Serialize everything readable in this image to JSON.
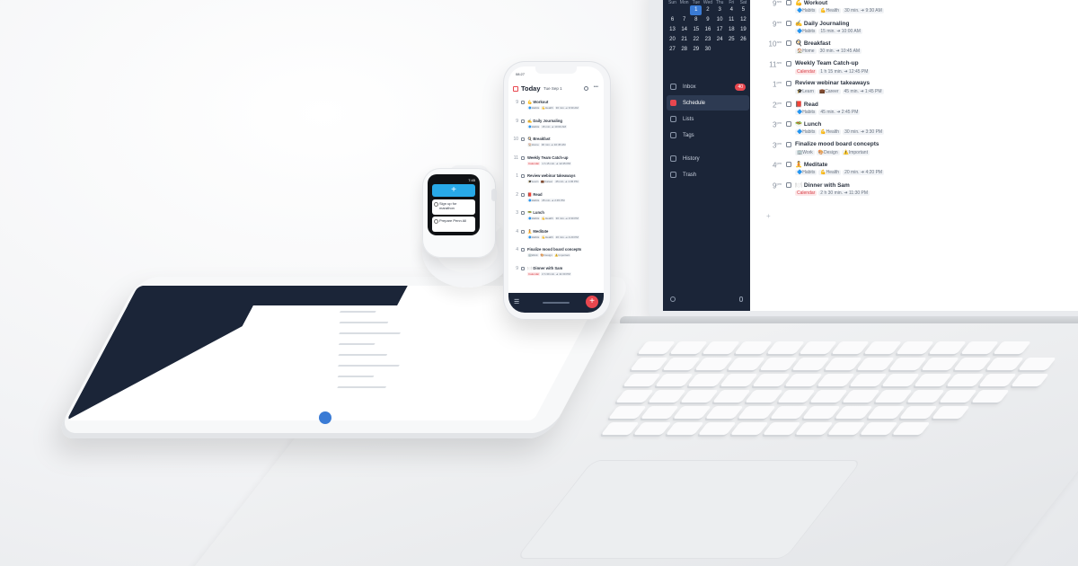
{
  "mac": {
    "calendar": {
      "weekdays": [
        "Sun",
        "Mon",
        "Tue",
        "Wed",
        "Thu",
        "Fri",
        "Sat"
      ],
      "weeks": [
        [
          "",
          "",
          "1",
          "2",
          "3",
          "4",
          "5"
        ],
        [
          "6",
          "7",
          "8",
          "9",
          "10",
          "11",
          "12"
        ],
        [
          "13",
          "14",
          "15",
          "16",
          "17",
          "18",
          "19"
        ],
        [
          "20",
          "21",
          "22",
          "23",
          "24",
          "25",
          "26"
        ],
        [
          "27",
          "28",
          "29",
          "30",
          "",
          "",
          ""
        ]
      ],
      "selected": "1"
    },
    "nav": [
      {
        "label": "Inbox",
        "badge": "40"
      },
      {
        "label": "Schedule",
        "badge": ""
      },
      {
        "label": "Lists",
        "badge": ""
      },
      {
        "label": "Tags",
        "badge": ""
      },
      {
        "label": "History",
        "badge": ""
      },
      {
        "label": "Trash",
        "badge": ""
      }
    ],
    "tasks": [
      {
        "time": "9",
        "ampm": "am",
        "title": "💪 Workout",
        "meta": [
          {
            "t": "🔷Habits"
          },
          {
            "t": "💪Health"
          },
          {
            "t": "30 min. ➜ 9:30 AM"
          }
        ]
      },
      {
        "time": "9",
        "ampm": "am",
        "title": "✍️ Daily Journaling",
        "meta": [
          {
            "t": "🔷Habits"
          },
          {
            "t": "15 min. ➜ 10:00 AM"
          }
        ]
      },
      {
        "time": "10",
        "ampm": "am",
        "title": "🍳 Breakfast",
        "meta": [
          {
            "t": "🏠Home"
          },
          {
            "t": "30 min. ➜ 10:45 AM"
          }
        ]
      },
      {
        "time": "11",
        "ampm": "am",
        "title": "Weekly Team Catch-up",
        "meta": [
          {
            "t": "Calendar",
            "red": true
          },
          {
            "t": "1 h 15 min. ➜ 12:45 PM"
          }
        ]
      },
      {
        "time": "1",
        "ampm": "pm",
        "title": "Review webinar takeaways",
        "meta": [
          {
            "t": "🎓Learn"
          },
          {
            "t": "💼Career"
          },
          {
            "t": "45 min. ➜ 1:45 PM"
          }
        ]
      },
      {
        "time": "2",
        "ampm": "pm",
        "title": "📕 Read",
        "meta": [
          {
            "t": "🔷Habits"
          },
          {
            "t": "45 min. ➜ 2:45 PM"
          }
        ]
      },
      {
        "time": "3",
        "ampm": "pm",
        "title": "🥗 Lunch",
        "meta": [
          {
            "t": "🔷Habits"
          },
          {
            "t": "💪Health"
          },
          {
            "t": "30 min. ➜ 3:30 PM"
          }
        ]
      },
      {
        "time": "3",
        "ampm": "pm",
        "title": "Finalize mood board concepts",
        "meta": [
          {
            "t": "🏢Work"
          },
          {
            "t": "🎨Design"
          },
          {
            "t": "⚠️Important"
          }
        ]
      },
      {
        "time": "4",
        "ampm": "pm",
        "title": "🧘 Meditate",
        "meta": [
          {
            "t": "🔷Habits"
          },
          {
            "t": "💪Health"
          },
          {
            "t": "20 min. ➜ 4:20 PM"
          }
        ]
      },
      {
        "time": "9",
        "ampm": "pm",
        "title": "🍽️ Dinner with Sam",
        "meta": [
          {
            "t": "Calendar",
            "red": true
          },
          {
            "t": "2 h 30 min. ➜ 11:30 PM"
          }
        ]
      }
    ]
  },
  "phone": {
    "status_time": "08:27",
    "title": "Today",
    "date": "Tue Sep 1",
    "tasks": [
      {
        "time": "9",
        "title": "💪 Workout",
        "meta": [
          {
            "t": "🔷Habits"
          },
          {
            "t": "💪Health"
          },
          {
            "t": "30 min. ➜ 9:30 AM"
          }
        ]
      },
      {
        "time": "9",
        "title": "✍️ Daily Journaling",
        "meta": [
          {
            "t": "🔷Habits"
          },
          {
            "t": "15 min. ➜ 10:00 AM"
          }
        ]
      },
      {
        "time": "10",
        "title": "🍳 Breakfast",
        "meta": [
          {
            "t": "🏠Home"
          },
          {
            "t": "30 min. ➜ 10:45 AM"
          }
        ]
      },
      {
        "time": "11",
        "title": "Weekly Team Catch-up",
        "meta": [
          {
            "t": "Calendar",
            "red": true
          },
          {
            "t": "1 h 15 min. ➜ 12:45 PM"
          }
        ]
      },
      {
        "time": "1",
        "title": "Review webinar takeaways",
        "meta": [
          {
            "t": "🎓Learn"
          },
          {
            "t": "💼Career"
          },
          {
            "t": "45 min. ➜ 1:45 PM"
          }
        ]
      },
      {
        "time": "2",
        "title": "📕 Read",
        "meta": [
          {
            "t": "🔷Habits"
          },
          {
            "t": "45 min. ➜ 2:45 PM"
          }
        ]
      },
      {
        "time": "3",
        "title": "🥗 Lunch",
        "meta": [
          {
            "t": "🔷Habits"
          },
          {
            "t": "💪Health"
          },
          {
            "t": "30 min. ➜ 3:30 PM"
          }
        ]
      },
      {
        "time": "4",
        "title": "🧘 Meditate",
        "meta": [
          {
            "t": "🔷Habits"
          },
          {
            "t": "💪Health"
          },
          {
            "t": "20 min. ➜ 4:20 PM"
          }
        ]
      },
      {
        "time": "4",
        "title": "Finalize mood board concepts",
        "meta": [
          {
            "t": "🏢Work"
          },
          {
            "t": "🎨Design"
          },
          {
            "t": "⚠️Important"
          }
        ]
      },
      {
        "time": "9",
        "title": "🍽️ Dinner with Sam",
        "meta": [
          {
            "t": "Calendar",
            "red": true
          },
          {
            "t": "2 h 30 min. ➜ 11:30 PM"
          }
        ]
      }
    ]
  },
  "watch": {
    "time": "7:45",
    "cards": [
      "Sign up for marathon",
      "Prepare Penn All"
    ]
  },
  "colors": {
    "accent": "#e8474f",
    "sidebar": "#1b2538",
    "watch_accent": "#28a9e8"
  }
}
